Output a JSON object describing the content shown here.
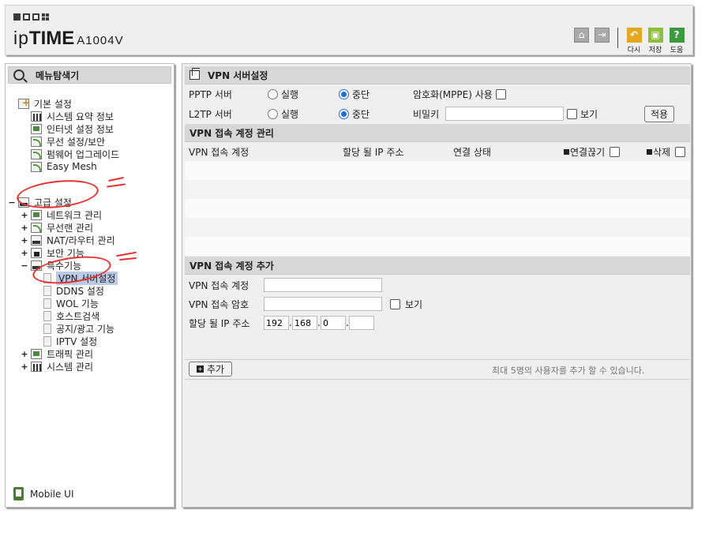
{
  "header": {
    "brand_prefix": "ip",
    "brand_main": "TIME",
    "model": "A1004V",
    "tools": [
      {
        "icon": "refresh-icon",
        "label": "다시",
        "color": "#e4a820"
      },
      {
        "icon": "save-icon",
        "label": "저장",
        "color": "#8cbf3a"
      },
      {
        "icon": "help-icon",
        "label": "도움",
        "color": "#3e9a3e",
        "glyph": "?"
      }
    ],
    "home_icon": "home-icon",
    "logout_icon": "logout-icon"
  },
  "sidebar": {
    "title": "메뉴탐색기",
    "basic": {
      "label": "기본 설정",
      "items": [
        "시스템 요약 정보",
        "인터넷 설정 정보",
        "무선 설정/보안",
        "펌웨어 업그레이드",
        "Easy Mesh"
      ]
    },
    "advanced": {
      "label": "고급 설정",
      "items": [
        "네트워크 관리",
        "무선랜 관리",
        "NAT/라우터 관리",
        "보안 기능"
      ],
      "special": {
        "label": "특수기능",
        "items": [
          "VPN 서버설정",
          "DDNS 설정",
          "WOL 기능",
          "호스트검색",
          "공지/광고 기능",
          "IPTV 설정"
        ]
      },
      "items_after": [
        "트래픽 관리",
        "시스템 관리"
      ]
    },
    "mobile_ui": "Mobile UI"
  },
  "main": {
    "title": "VPN 서버설정",
    "pptp": {
      "label": "PPTP 서버",
      "run": "실행",
      "stop": "중단",
      "selected": "중단"
    },
    "l2tp": {
      "label": "L2TP 서버",
      "run": "실행",
      "stop": "중단",
      "selected": "중단"
    },
    "mppe_label": "암호화(MPPE) 사용",
    "secret_label": "비밀키",
    "secret_value": "",
    "show_label": "보기",
    "apply_button": "적용",
    "accounts_section": "VPN 접속 계정 관리",
    "accounts_columns": [
      "VPN 접속 계정",
      "할당 될 IP 주소",
      "연결 상태",
      "연결끊기",
      "삭제"
    ],
    "add_section": "VPN 접속 계정 추가",
    "account_label": "VPN 접속 계정",
    "account_value": "",
    "password_label": "VPN 접속 암호",
    "password_value": "",
    "password_show": "보기",
    "ip_label": "할당 될 IP 주소",
    "ip_parts": [
      "192",
      "168",
      "0",
      ""
    ],
    "add_button": "추가",
    "max_users_note": "최대 5명의 사용자를 추가 할 수 있습니다."
  }
}
